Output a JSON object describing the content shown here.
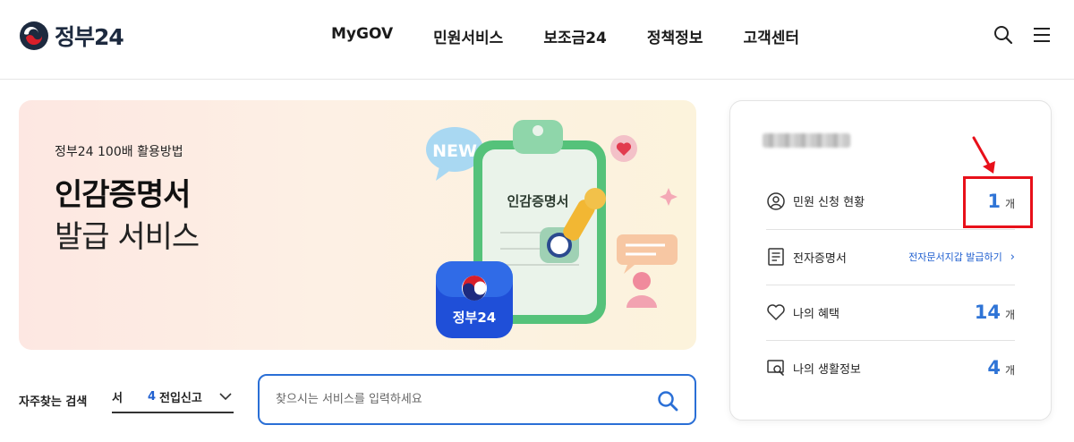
{
  "header": {
    "logo_text": "정부24",
    "nav": [
      "MyGOV",
      "민원서비스",
      "보조금24",
      "정책정보",
      "고객센터"
    ],
    "icons": {
      "search": "search-icon",
      "menu": "hamburger-menu-icon"
    }
  },
  "banner": {
    "subtitle": "정부24 100배 활용방법",
    "title_line1": "인감증명서",
    "title_line2": "발급 서비스",
    "art": {
      "bubble_text": "NEW",
      "clipboard_text": "인감증명서",
      "app_icon_text": "정부24"
    }
  },
  "search": {
    "frequent_label": "자주찾는 검색",
    "frequent_cut": "서",
    "frequent_rank": "4",
    "frequent_keyword": "전입신고",
    "placeholder": "찾으시는 서비스를 입력하세요"
  },
  "panel": {
    "rows": [
      {
        "label": "민원 신청 현황",
        "count": "1",
        "unit": "개",
        "icon": "user-circle-icon"
      },
      {
        "label": "전자증명서",
        "link": "전자문서지갑 발급하기",
        "icon": "document-icon"
      },
      {
        "label": "나의 혜택",
        "count": "14",
        "unit": "개",
        "icon": "heart-icon"
      },
      {
        "label": "나의 생활정보",
        "count": "4",
        "unit": "개",
        "icon": "search-monitor-icon"
      }
    ]
  },
  "colors": {
    "accent": "#2f74d6",
    "link": "#2160d0",
    "highlight": "#e8101a",
    "banner_bg": "#fdeee3"
  }
}
